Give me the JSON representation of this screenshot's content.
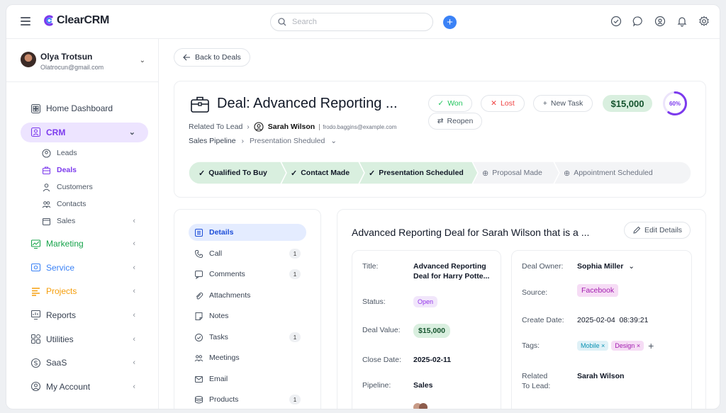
{
  "app": {
    "logo_text": "ClearCRM",
    "brand_color": "#7c3aed",
    "accent_blue": "#3b82f6"
  },
  "search": {
    "placeholder": "Search"
  },
  "user": {
    "name": "Olya Trotsun",
    "email": "Olatrocun@gmail.com"
  },
  "sidebar": {
    "items": [
      {
        "label": "Home Dashboard",
        "icon": "dashboard-icon"
      },
      {
        "label": "CRM",
        "icon": "crm-icon",
        "active": true
      },
      {
        "label": "Marketing",
        "icon": "marketing-icon",
        "color": "#16a34a"
      },
      {
        "label": "Service",
        "icon": "service-icon",
        "color": "#3b82f6"
      },
      {
        "label": "Projects",
        "icon": "projects-icon",
        "color": "#f59e0b"
      },
      {
        "label": "Reports",
        "icon": "reports-icon"
      },
      {
        "label": "Utilities",
        "icon": "utilities-icon"
      },
      {
        "label": "SaaS",
        "icon": "saas-icon"
      },
      {
        "label": "My Account",
        "icon": "account-icon"
      }
    ],
    "crm_sub": [
      {
        "label": "Leads",
        "icon": "leads-icon"
      },
      {
        "label": "Deals",
        "icon": "deals-icon",
        "active": true
      },
      {
        "label": "Customers",
        "icon": "customers-icon"
      },
      {
        "label": "Contacts",
        "icon": "contacts-icon"
      },
      {
        "label": "Sales",
        "icon": "sales-icon"
      }
    ]
  },
  "main": {
    "back_label": "Back to Deals",
    "deal_title": "Deal: Advanced Reporting ...",
    "related_label": "Related To Lead",
    "related_name": "Sarah Wilson",
    "related_email": "frodo.baggins@example.com",
    "pipeline_name": "Sales Pipeline",
    "pipeline_stage": "Presentation Sheduled",
    "won_label": "Won",
    "lost_label": "Lost",
    "new_task_label": "New Task",
    "reopen_label": "Reopen",
    "amount": "$15,000",
    "progress_label": "60%",
    "progress_value": 0.6,
    "stages": [
      {
        "label": "Qualified To Buy",
        "done": true
      },
      {
        "label": "Contact Made",
        "done": true
      },
      {
        "label": "Presentation Scheduled",
        "done": true
      },
      {
        "label": "Proposal Made",
        "done": false
      },
      {
        "label": "Appointment Scheduled",
        "done": false
      }
    ]
  },
  "tabs": [
    {
      "label": "Details",
      "icon": "details-icon",
      "active": true,
      "count": ""
    },
    {
      "label": "Call",
      "icon": "phone-icon",
      "count": "1"
    },
    {
      "label": "Comments",
      "icon": "comment-icon",
      "count": "1"
    },
    {
      "label": "Attachments",
      "icon": "paperclip-icon",
      "count": ""
    },
    {
      "label": "Notes",
      "icon": "note-icon",
      "count": ""
    },
    {
      "label": "Tasks",
      "icon": "tasks-icon",
      "count": "1"
    },
    {
      "label": "Meetings",
      "icon": "meetings-icon",
      "count": ""
    },
    {
      "label": "Email",
      "icon": "email-icon",
      "count": ""
    },
    {
      "label": "Products",
      "icon": "products-icon",
      "count": "1"
    }
  ],
  "details": {
    "title": "Advanced Reporting Deal for Sarah Wilson that is a ...",
    "edit_label": "Edit Details",
    "title_label": "Title:",
    "title_value_1": "Advanced Reporting",
    "title_value_2": "Deal for Harry Potte...",
    "status_label": "Status:",
    "status_value": "Open",
    "deal_value_label": "Deal Value:",
    "deal_value": "$15,000",
    "close_date_label": "Close Date:",
    "close_date": "2025-02-11",
    "pipeline_label": "Pipeline:",
    "pipeline_value": "Sales",
    "owner_label": "Deal Owner:",
    "owner_value": "Sophia Miller",
    "source_label": "Source:",
    "source_value": "Facebook",
    "create_date_label": "Create Date:",
    "create_date": "2025-02-04  08:39:21",
    "tags_label": "Tags:",
    "tags": [
      "Mobile",
      "Design"
    ],
    "related_label_1": "Related",
    "related_label_2": "To Lead:",
    "related_value": "Sarah Wilson"
  }
}
